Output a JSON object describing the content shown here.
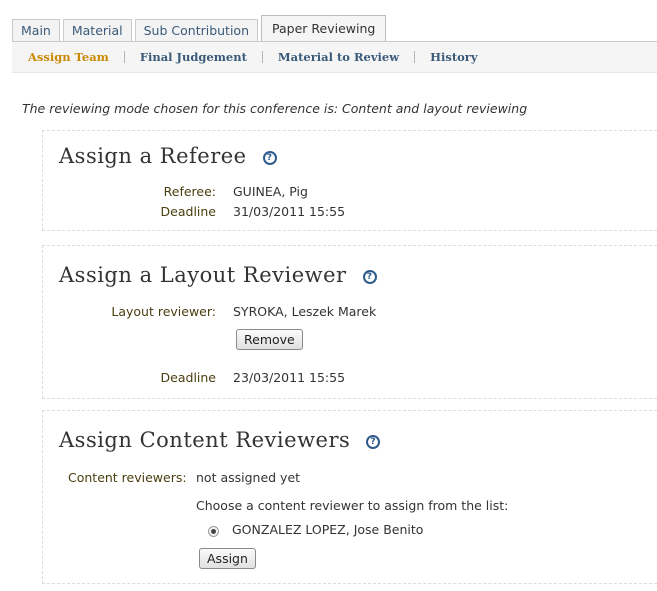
{
  "tabs": [
    {
      "label": "Main"
    },
    {
      "label": "Material"
    },
    {
      "label": "Sub Contribution"
    },
    {
      "label": "Paper Reviewing",
      "active": true
    }
  ],
  "subnav": [
    {
      "label": "Assign Team",
      "active": true
    },
    {
      "label": "Final Judgement"
    },
    {
      "label": "Material to Review"
    },
    {
      "label": "History"
    }
  ],
  "mode_text": "The reviewing mode chosen for this conference is: Content and layout reviewing",
  "referee": {
    "title": "Assign a Referee",
    "help_icon": "help-icon",
    "referee_label": "Referee:",
    "referee_value": "GUINEA, Pig",
    "deadline_label": "Deadline",
    "deadline_value": "31/03/2011 15:55"
  },
  "layout": {
    "title": "Assign a Layout Reviewer",
    "help_icon": "help-icon",
    "reviewer_label": "Layout reviewer:",
    "reviewer_value": "SYROKA, Leszek Marek",
    "remove_label": "Remove",
    "deadline_label": "Deadline",
    "deadline_value": "23/03/2011 15:55"
  },
  "content": {
    "title": "Assign Content Reviewers",
    "help_icon": "help-icon",
    "reviewers_label": "Content reviewers:",
    "reviewers_value": "not assigned yet",
    "choose_text": "Choose a content reviewer to assign from the list:",
    "options": [
      {
        "label": "GONZALEZ LOPEZ, Jose Benito",
        "selected": true
      }
    ],
    "assign_label": "Assign"
  },
  "colors": {
    "link": "#3a5a78",
    "active_subnav": "#c98900",
    "label": "#4a3f10",
    "help_icon": "#2f5b8c"
  }
}
